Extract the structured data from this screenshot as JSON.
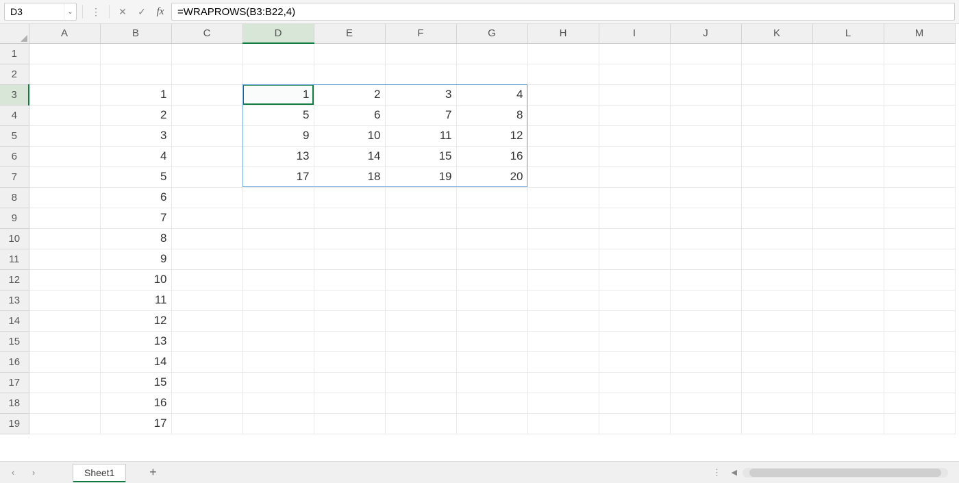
{
  "formula_bar": {
    "cell_ref": "D3",
    "formula": "=WRAPROWS(B3:B22,4)",
    "fx_label": "fx",
    "cancel_icon": "✕",
    "accept_icon": "✓",
    "more_icon": "⋮",
    "chevron": "⌄"
  },
  "columns": [
    "A",
    "B",
    "C",
    "D",
    "E",
    "F",
    "G",
    "H",
    "I",
    "J",
    "K",
    "L",
    "M"
  ],
  "row_count": 19,
  "active_cell": {
    "row": 3,
    "col": "D"
  },
  "spill_range": {
    "row_start": 3,
    "row_end": 7,
    "col_start": "D",
    "col_end": "G"
  },
  "cells": {
    "B3": "1",
    "B4": "2",
    "B5": "3",
    "B6": "4",
    "B7": "5",
    "B8": "6",
    "B9": "7",
    "B10": "8",
    "B11": "9",
    "B12": "10",
    "B13": "11",
    "B14": "12",
    "B15": "13",
    "B16": "14",
    "B17": "15",
    "B18": "16",
    "B19": "17",
    "D3": "1",
    "E3": "2",
    "F3": "3",
    "G3": "4",
    "D4": "5",
    "E4": "6",
    "F4": "7",
    "G4": "8",
    "D5": "9",
    "E5": "10",
    "F5": "11",
    "G5": "12",
    "D6": "13",
    "E6": "14",
    "F6": "15",
    "G6": "16",
    "D7": "17",
    "E7": "18",
    "F7": "19",
    "G7": "20"
  },
  "sheet_bar": {
    "prev": "‹",
    "next": "›",
    "tabs": [
      "Sheet1"
    ],
    "active_tab": "Sheet1",
    "add": "+",
    "more": "⋮",
    "scroll_left": "◀"
  }
}
